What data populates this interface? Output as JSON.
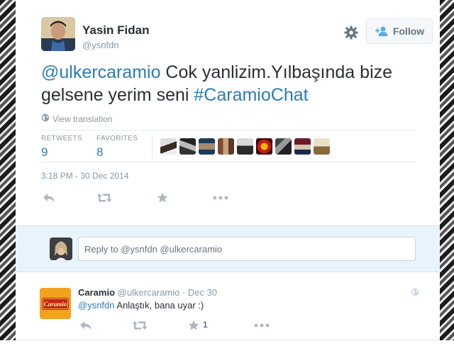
{
  "tweet": {
    "author_name": "Yasin Fidan",
    "author_handle": "@ysnfdn",
    "follow_label": "Follow",
    "text_mention": "@ulkercaramio",
    "text_body": " Cok yanlizim.Yılbaşında bize gelsene yerim seni ",
    "text_hashtag": "#CaramioChat",
    "view_translation": "View translation",
    "stats": {
      "retweets_label": "RETWEETS",
      "retweets_value": "9",
      "favorites_label": "FAVORITES",
      "favorites_value": "8",
      "favoriter_count_shown": 9
    },
    "timestamp": "3:18 PM - 30 Dec 2014",
    "actions": [
      "reply-icon",
      "retweet-icon",
      "favorite-icon",
      "more-icon"
    ]
  },
  "reply_box": {
    "placeholder": "Reply to @ysnfdn @ulkercaramio"
  },
  "reply": {
    "author_name": "Caramio",
    "author_handle": "@ulkercaramio",
    "separator": " · ",
    "date": "Dec 30",
    "mention": "@ysnfdn",
    "text": " Anlaştık, bana uyar :)",
    "favorite_count": "1",
    "avatar_brand": "Caramio"
  },
  "colors": {
    "link": "#2b7bb9",
    "muted": "#8899a6",
    "reply_bg": "#e8f4fb",
    "brand_orange": "#f2a21c"
  }
}
